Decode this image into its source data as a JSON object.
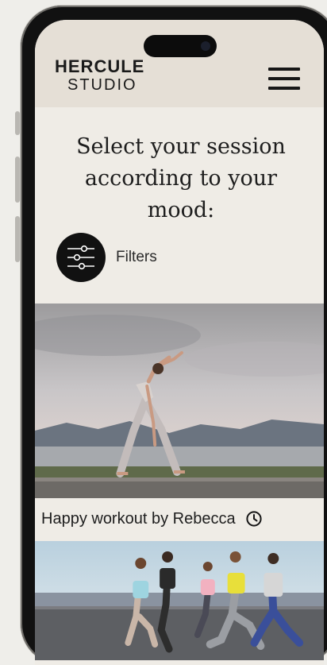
{
  "brand": {
    "line1": "HERCULE",
    "line2": "STUDIO"
  },
  "nav": {
    "menu_icon": "hamburger-menu-icon"
  },
  "hero": {
    "title": "Select your session according to your mood:"
  },
  "filters": {
    "label": "Filters",
    "icon": "sliders-icon"
  },
  "sessions": [
    {
      "title": "Happy workout by Rebecca",
      "icon": "clock-icon"
    }
  ],
  "colors": {
    "page_bg": "#efeeea",
    "header_bg": "#e5dfd6",
    "screen_bg": "#efece6",
    "text": "#1d1d1d",
    "accent_dark": "#111111"
  }
}
